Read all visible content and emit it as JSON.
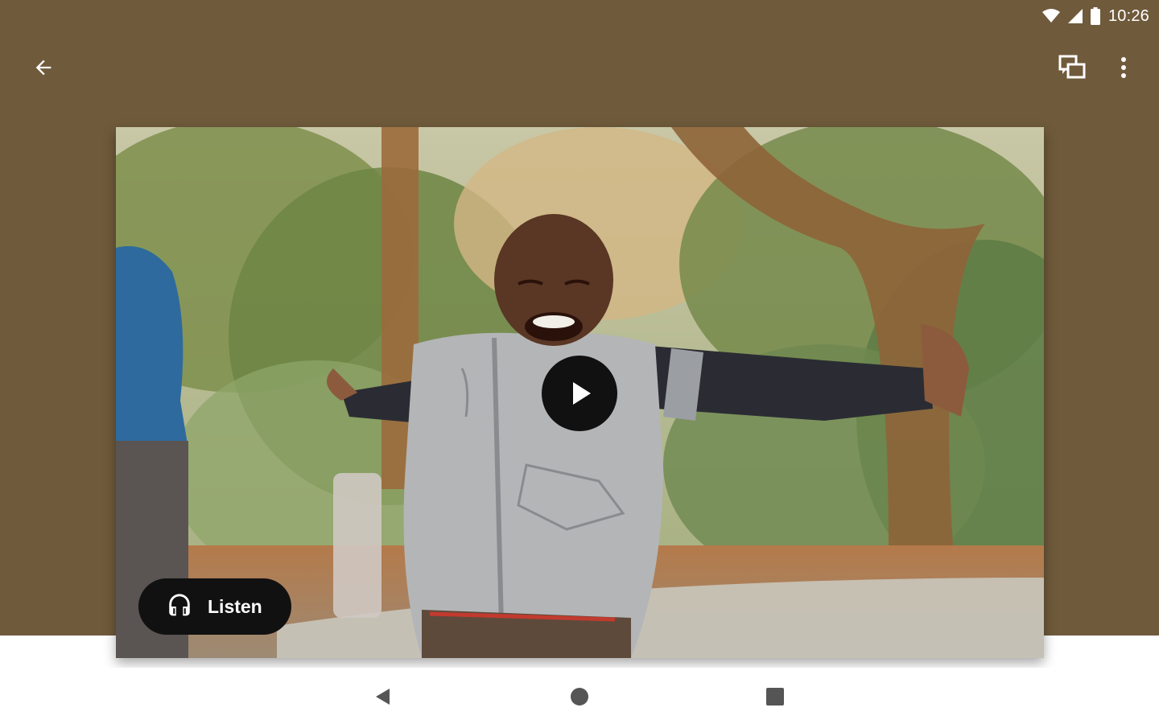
{
  "status_bar": {
    "time": "10:26",
    "icons": [
      "wifi-icon",
      "cellular-signal-icon",
      "battery-icon"
    ]
  },
  "toolbar": {
    "back_icon": "arrow-back-icon",
    "cast_icon": "cast-screens-icon",
    "more_icon": "more-vert-icon"
  },
  "media": {
    "play_icon": "play-icon",
    "listen_label": "Listen",
    "listen_icon": "headphones-icon"
  },
  "nav_bar": {
    "icons": [
      "nav-back-icon",
      "nav-home-icon",
      "nav-recents-icon"
    ]
  },
  "colors": {
    "background": "#6f5a3b",
    "overlay_button": "#111111",
    "icon": "#ffffff",
    "nav_icon": "#555555"
  }
}
